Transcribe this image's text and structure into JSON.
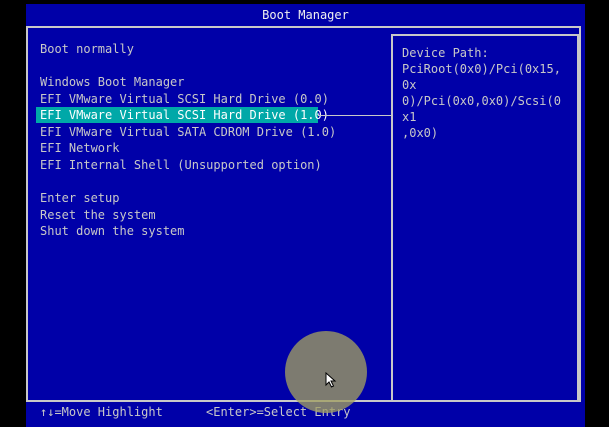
{
  "title": "Boot Manager",
  "menu": {
    "items": [
      {
        "label": "Boot normally",
        "selected": false
      },
      {
        "label": "Windows Boot Manager",
        "selected": false
      },
      {
        "label": "EFI VMware Virtual SCSI Hard Drive (0.0)",
        "selected": false
      },
      {
        "label": "EFI VMware Virtual SCSI Hard Drive (1.0)",
        "selected": true
      },
      {
        "label": "EFI VMware Virtual SATA CDROM Drive (1.0)",
        "selected": false
      },
      {
        "label": "EFI Network",
        "selected": false
      },
      {
        "label": "EFI Internal Shell (Unsupported option)",
        "selected": false
      },
      {
        "label": "Enter setup",
        "selected": false
      },
      {
        "label": "Reset the system",
        "selected": false
      },
      {
        "label": "Shut down the system",
        "selected": false
      }
    ]
  },
  "details": {
    "heading": "Device Path:",
    "lines": [
      "PciRoot(0x0)/Pci(0x15,0x",
      "0)/Pci(0x0,0x0)/Scsi(0x1",
      ",0x0)"
    ]
  },
  "footer": {
    "navigate_hint": "↑↓=Move Highlight",
    "select_hint": "<Enter>=Select Entry"
  },
  "colors": {
    "background": "#0000a8",
    "highlight": "#00a8a8",
    "text": "#c8c8c8"
  },
  "icons": {
    "cursor": "mouse-pointer-icon"
  }
}
